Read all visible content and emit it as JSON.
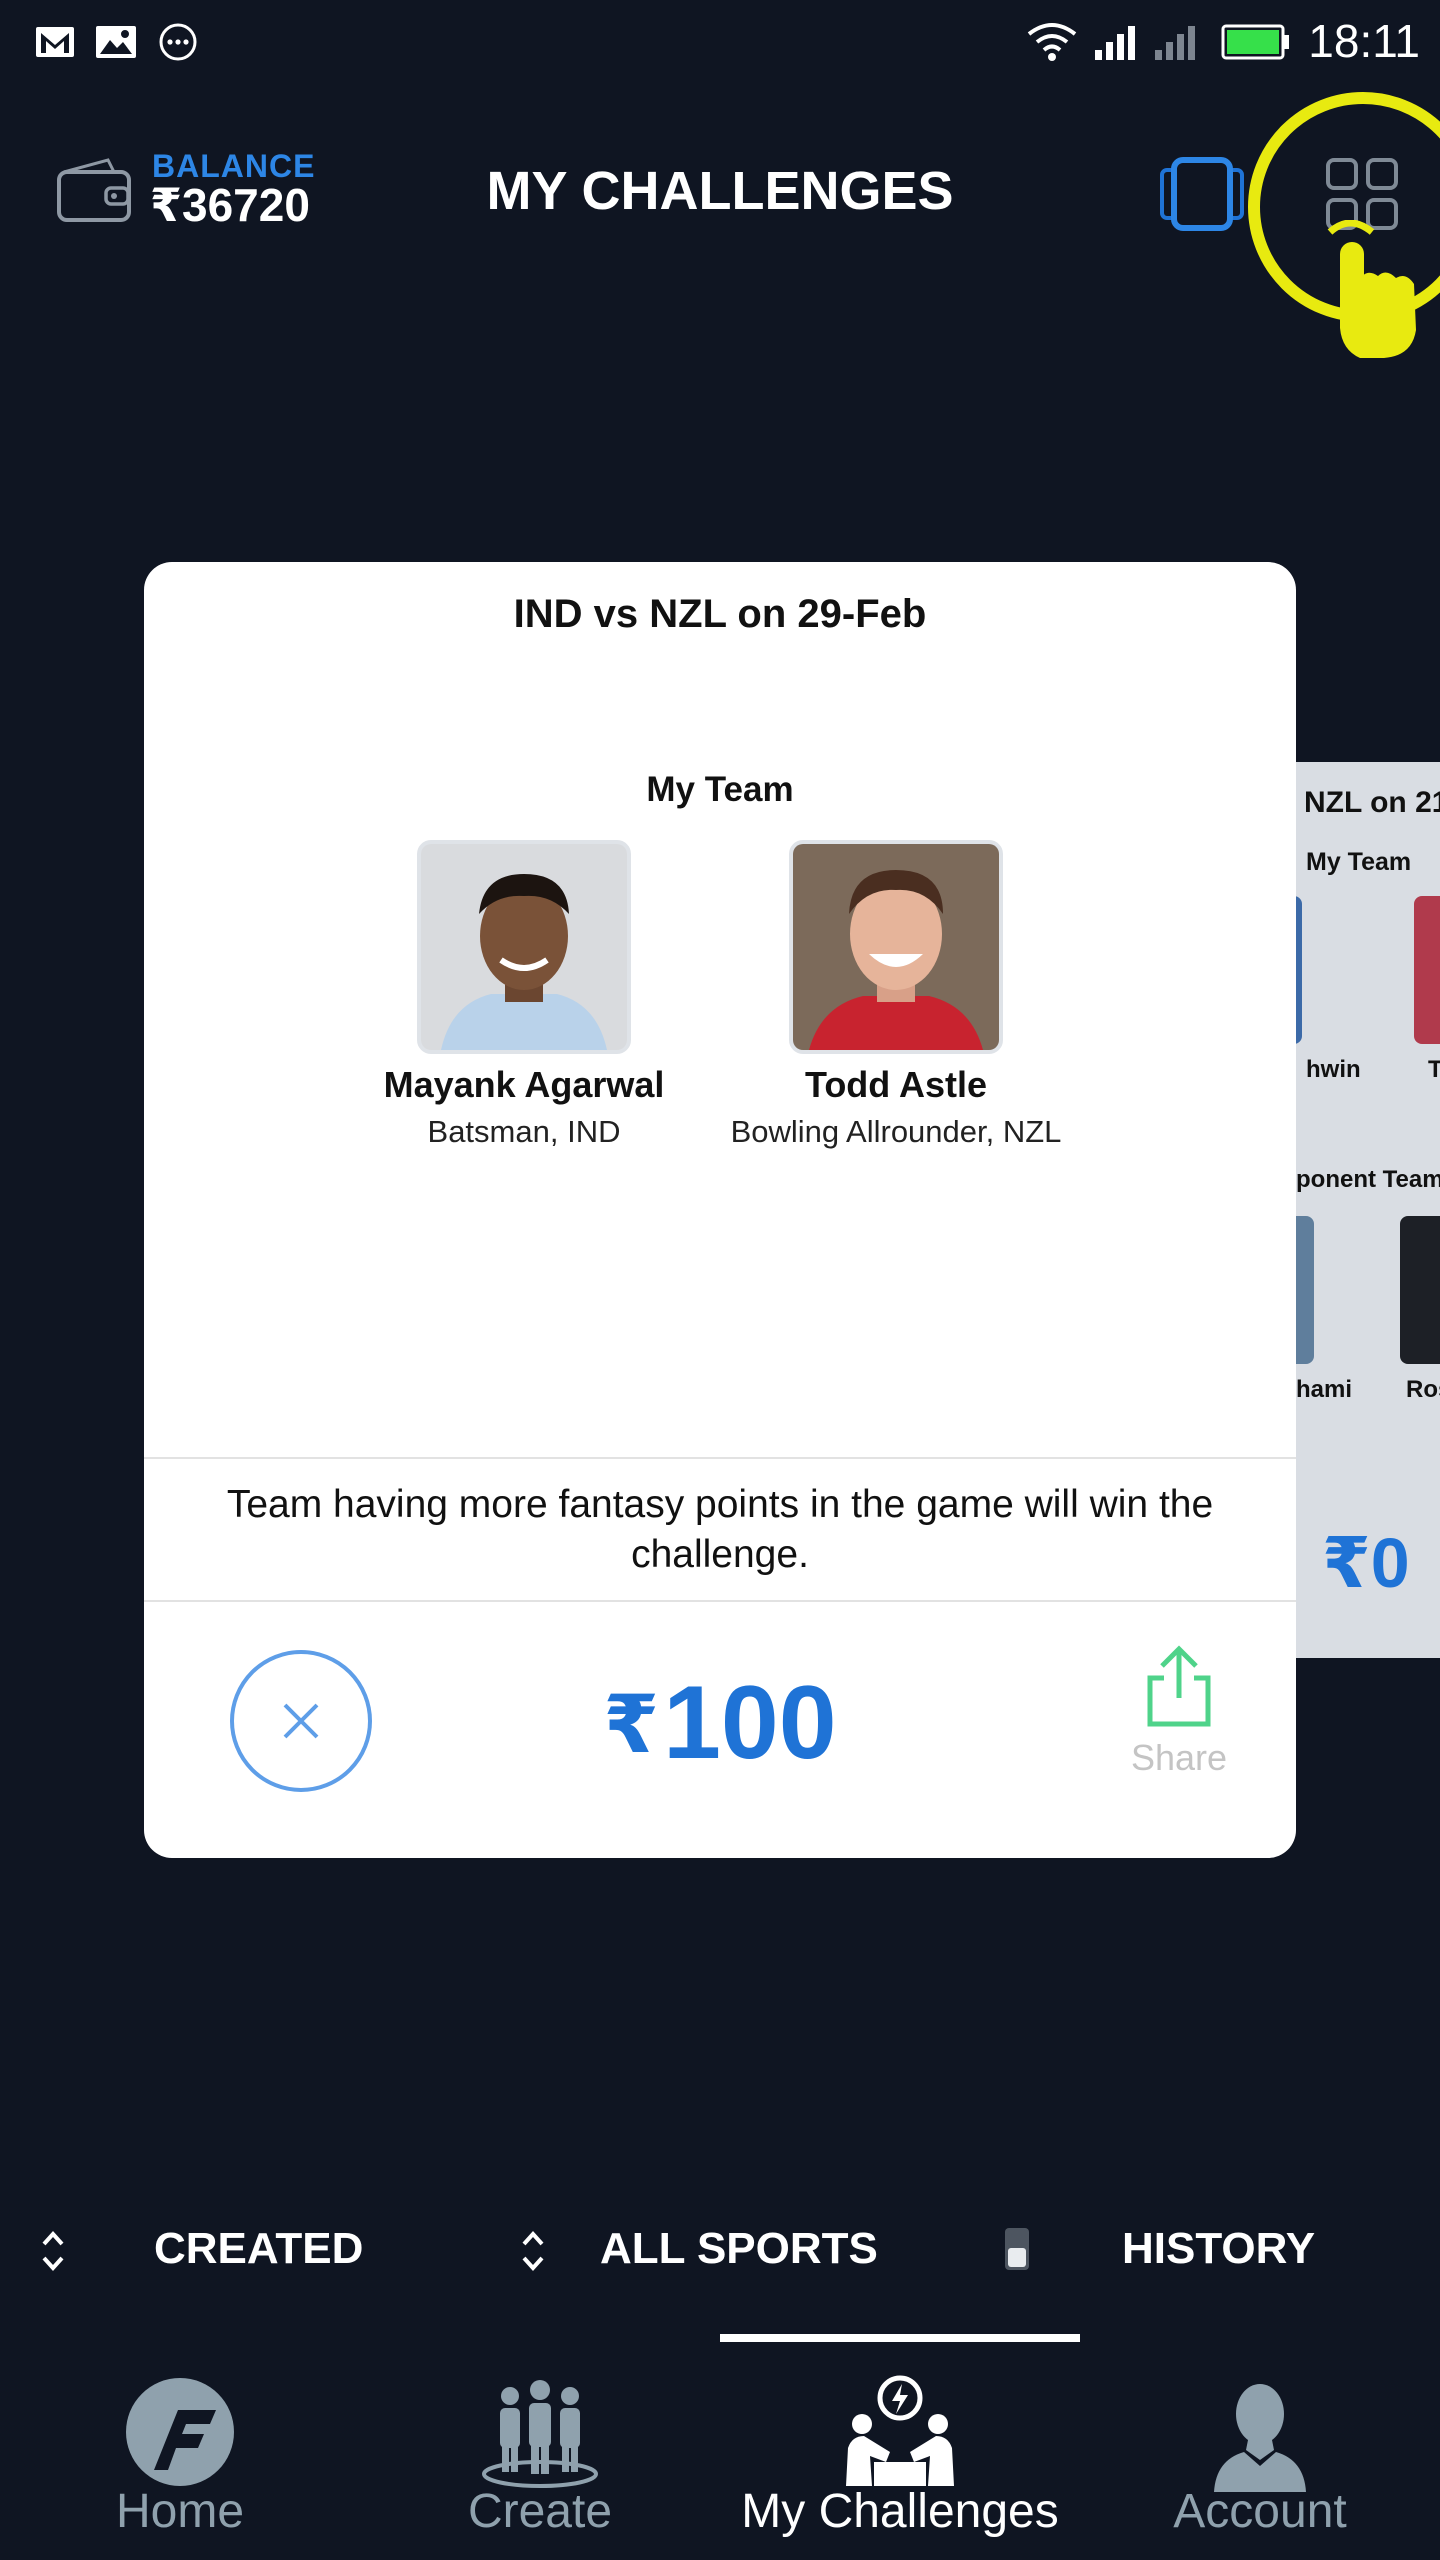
{
  "status_bar": {
    "time": "18:11",
    "icons": [
      "gmail-icon",
      "gallery-icon",
      "more-icon",
      "wifi-icon",
      "signal-icon",
      "signal-icon-2",
      "battery-icon"
    ]
  },
  "header": {
    "balance_label": "BALANCE",
    "balance_value": "₹36720",
    "title": "MY CHALLENGES"
  },
  "card": {
    "title": "IND vs NZL on 29-Feb",
    "team_label": "My Team",
    "players": [
      {
        "name": "Mayank Agarwal",
        "role": "Batsman, IND"
      },
      {
        "name": "Todd Astle",
        "role": "Bowling Allrounder, NZL"
      }
    ],
    "rule_text": "Team having more fantasy points in the game will win the challenge.",
    "amount": "100",
    "currency": "₹",
    "share_label": "Share"
  },
  "peek_card": {
    "title": "NZL on 21",
    "team_label": "My Team",
    "players": [
      "hwin",
      "T"
    ],
    "opponent_label": "ponent Team",
    "opponents": [
      "hami",
      "Ros"
    ],
    "amount": "₹0"
  },
  "filters": {
    "created": "CREATED",
    "sports": "ALL SPORTS",
    "history": "HISTORY"
  },
  "bottom_nav": {
    "items": [
      {
        "label": "Home",
        "active": false
      },
      {
        "label": "Create",
        "active": false
      },
      {
        "label": "My Challenges",
        "active": true
      },
      {
        "label": "Account",
        "active": false
      }
    ]
  },
  "colors": {
    "background": "#0f1522",
    "accent": "#1f73d6",
    "highlight": "#e8ea10",
    "share": "#4fd38a"
  }
}
